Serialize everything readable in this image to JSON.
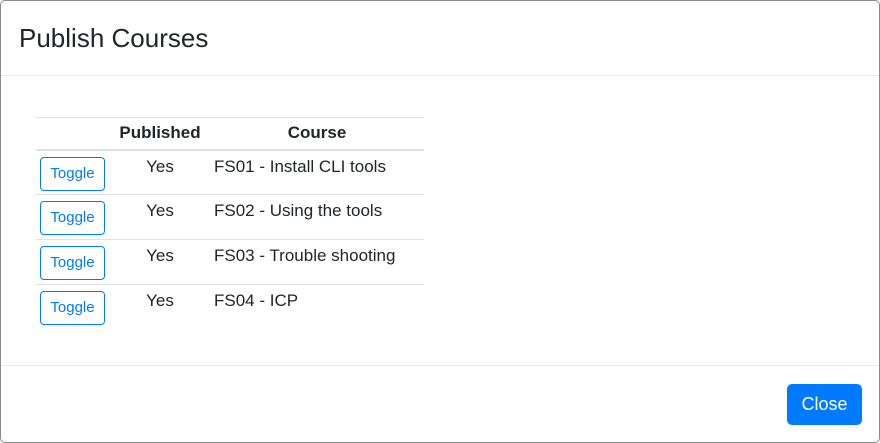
{
  "dialog": {
    "title": "Publish Courses",
    "close_label": "Close"
  },
  "table": {
    "headers": {
      "toggle": "",
      "published": "Published",
      "course": "Course"
    },
    "rows": [
      {
        "toggle_label": "Toggle",
        "published": "Yes",
        "course": "FS01 - Install CLI tools"
      },
      {
        "toggle_label": "Toggle",
        "published": "Yes",
        "course": "FS02 - Using the tools"
      },
      {
        "toggle_label": "Toggle",
        "published": "Yes",
        "course": "FS03 - Trouble shooting"
      },
      {
        "toggle_label": "Toggle",
        "published": "Yes",
        "course": "FS04 - ICP"
      }
    ]
  },
  "colors": {
    "primary": "#007bff",
    "text": "#212529",
    "border": "#dee2e6"
  }
}
